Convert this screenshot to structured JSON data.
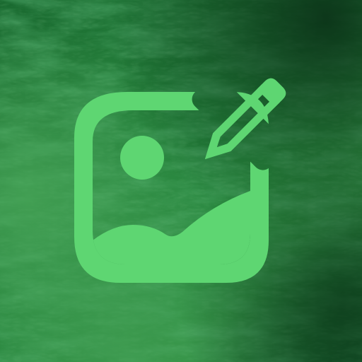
{
  "icon": {
    "name": "image-edit-icon",
    "colors": {
      "background_dark": "#0b3a1a",
      "background_mid": "#1f7a34",
      "background_light": "#3a9a4a",
      "glyph": "#5ed672"
    },
    "parts": [
      "photo-frame",
      "sun-circle",
      "mountain-landscape",
      "pencil"
    ]
  }
}
